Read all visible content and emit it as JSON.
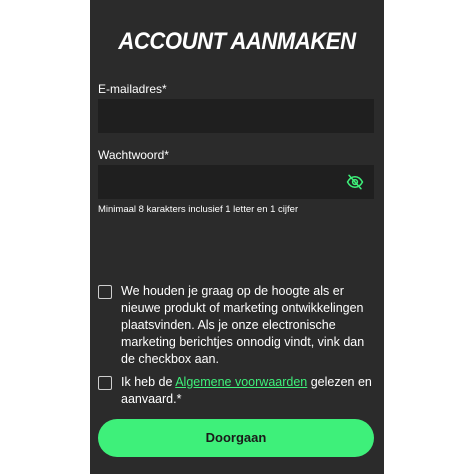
{
  "header": {
    "title": "ACCOUNT AANMAKEN"
  },
  "form": {
    "email_label": "E-mailadres*",
    "email_value": "",
    "password_label": "Wachtwoord*",
    "password_value": "",
    "password_toggle_icon": "eye-off-icon",
    "password_hint": "Minimaal 8 karakters inclusief 1 letter en 1 cijfer"
  },
  "consents": {
    "marketing_checked": false,
    "marketing_text": "We houden je graag op de hoogte als er nieuwe produkt of marketing ontwikkelingen plaatsvinden. Als je onze electronische marketing berichtjes onnodig vindt, vink dan de checkbox aan.",
    "terms_checked": false,
    "terms_prefix": "Ik heb de ",
    "terms_link": "Algemene voorwaarden",
    "terms_suffix": " gelezen en aanvaard.*"
  },
  "submit": {
    "label": "Doorgaan"
  },
  "colors": {
    "panel_bg": "#2b2b2b",
    "input_bg": "#1f1f1f",
    "accent": "#3ef07a"
  }
}
